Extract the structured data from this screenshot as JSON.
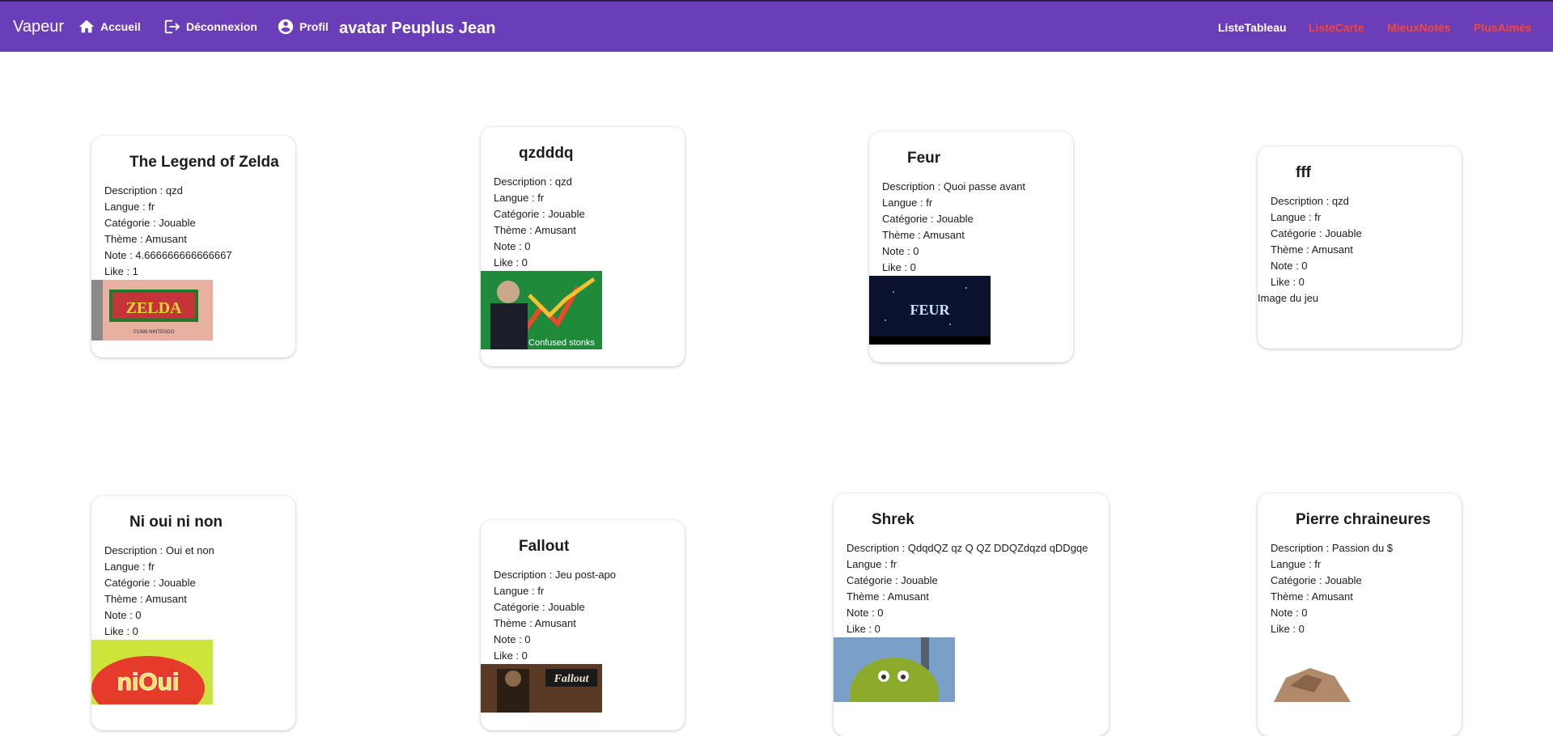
{
  "nav": {
    "brand": "Vapeur",
    "home_label": "Accueil",
    "logout_label": "Déconnexion",
    "profile_label": "Profil",
    "user_label": "avatar Peuplus Jean",
    "links": [
      "ListeTableau",
      "ListeCarte",
      "MieuxNotés",
      "PlusAimés"
    ],
    "colors": {
      "bar": "#6a3eb8",
      "inactive_link": "#f0473f"
    }
  },
  "cards": [
    {
      "title": "The Legend of Zelda",
      "description": "Description : qzd",
      "langue": "Langue : fr",
      "categorie": "Catégorie : Jouable",
      "theme": "Thème : Amusant",
      "note": "Note : 4.666666666666667",
      "like": "Like : 1",
      "image_alt": "",
      "image_text": "ZELDA"
    },
    {
      "title": "qzdddq",
      "description": "Description : qzd",
      "langue": "Langue : fr",
      "categorie": "Catégorie : Jouable",
      "theme": "Thème : Amusant",
      "note": "Note : 0",
      "like": "Like : 0",
      "image_alt": "",
      "image_text": "Confused stonks"
    },
    {
      "title": "Feur",
      "description": "Description : Quoi passe avant",
      "langue": "Langue : fr",
      "categorie": "Catégorie : Jouable",
      "theme": "Thème : Amusant",
      "note": "Note : 0",
      "like": "Like : 0",
      "image_alt": "",
      "image_text": "FEUR"
    },
    {
      "title": "fff",
      "description": "Description : qzd",
      "langue": "Langue : fr",
      "categorie": "Catégorie : Jouable",
      "theme": "Thème : Amusant",
      "note": "Note : 0",
      "like": "Like : 0",
      "image_alt": "Image du jeu",
      "image_text": ""
    },
    {
      "title": "Ni oui ni non",
      "description": "Description : Oui et non",
      "langue": "Langue : fr",
      "categorie": "Catégorie : Jouable",
      "theme": "Thème : Amusant",
      "note": "Note : 0",
      "like": "Like : 0",
      "image_alt": "",
      "image_text": "niOui"
    },
    {
      "title": "Fallout",
      "description": "Description : Jeu post-apo",
      "langue": "Langue : fr",
      "categorie": "Catégorie : Jouable",
      "theme": "Thème : Amusant",
      "note": "Note : 0",
      "like": "Like : 0",
      "image_alt": "",
      "image_text": "Fallout"
    },
    {
      "title": "Shrek",
      "description": "Description : QdqdQZ qz Q QZ DDQZdqzd qDDgqe",
      "langue": "Langue : fr",
      "categorie": "Catégorie : Jouable",
      "theme": "Thème : Amusant",
      "note": "Note : 0",
      "like": "Like : 0",
      "image_alt": "",
      "image_text": ""
    },
    {
      "title": "Pierre chraineures",
      "description": "Description : Passion du $",
      "langue": "Langue : fr",
      "categorie": "Catégorie : Jouable",
      "theme": "Thème : Amusant",
      "note": "Note : 0",
      "like": "Like : 0",
      "image_alt": "",
      "image_text": ""
    }
  ]
}
